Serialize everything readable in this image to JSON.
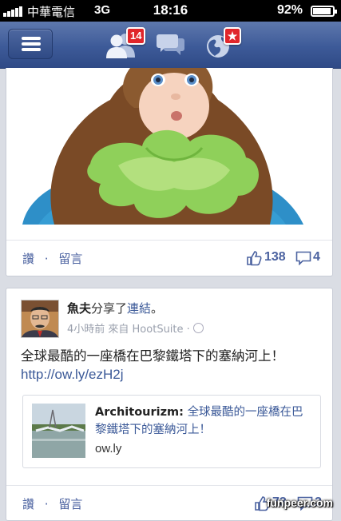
{
  "status_bar": {
    "carrier": "中華電信",
    "network": "3G",
    "time": "18:16",
    "battery": "92%",
    "battery_level": 0.92
  },
  "nav": {
    "friend_requests_badge": "14",
    "messages_icon": "chat-bubbles-icon",
    "notifications_icon": "globe-icon"
  },
  "top_post": {
    "like_label": "讚",
    "separator": "·",
    "comment_label": "留言",
    "likes": "138",
    "comments": "4"
  },
  "post": {
    "author": "魚夫",
    "shared_text": "分享了",
    "link_word": "連結",
    "period": "。",
    "meta": "4小時前 來自 HootSuite ·",
    "text": "全球最酷的一座橋在巴黎鐵塔下的塞納河上！",
    "url": "http://ow.ly/ezH2j",
    "share": {
      "source": "Architourizm:",
      "title": "全球最酷的一座橋在巴黎鐵塔下的塞納河上！",
      "domain": "ow.ly"
    },
    "like_label": "讚",
    "separator": "·",
    "comment_label": "留言",
    "likes": "73",
    "comments": "2"
  },
  "watermark": "funpeer.com",
  "colors": {
    "facebook_blue": "#3b5998",
    "badge_red": "#e0262b",
    "link_blue": "#4b62a0"
  }
}
